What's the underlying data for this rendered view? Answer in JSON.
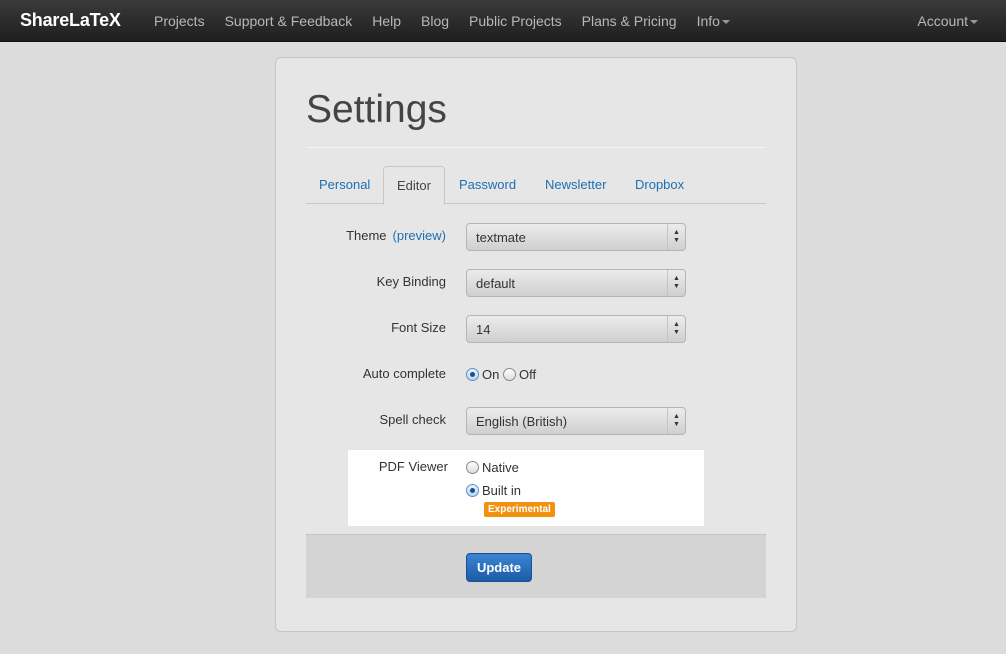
{
  "navbar": {
    "brand": "ShareLaTeX",
    "items": [
      "Projects",
      "Support & Feedback",
      "Help",
      "Blog",
      "Public Projects",
      "Plans & Pricing",
      "Info"
    ],
    "account": "Account"
  },
  "page": {
    "title": "Settings",
    "tabs": [
      "Personal",
      "Editor",
      "Password",
      "Newsletter",
      "Dropbox"
    ],
    "active_tab": "Editor"
  },
  "editor": {
    "theme": {
      "label": "Theme",
      "preview_link": "(preview)",
      "value": "textmate"
    },
    "key_binding": {
      "label": "Key Binding",
      "value": "default"
    },
    "font_size": {
      "label": "Font Size",
      "value": "14"
    },
    "auto_complete": {
      "label": "Auto complete",
      "on": "On",
      "off": "Off",
      "selected": "On"
    },
    "spell_check": {
      "label": "Spell check",
      "value": "English (British)"
    },
    "pdf_viewer": {
      "label": "PDF Viewer",
      "native": "Native",
      "built_in": "Built in",
      "badge": "Experimental",
      "selected": "Built in"
    }
  },
  "footer": {
    "update_label": "Update"
  },
  "colors": {
    "link": "#1f6fb2",
    "badge": "#f0920f",
    "button": "#2a72c0",
    "navbar": "#2b2b2b"
  },
  "icons": {
    "select_arrows": "updown-arrows-icon",
    "caret": "caret-down-icon"
  }
}
